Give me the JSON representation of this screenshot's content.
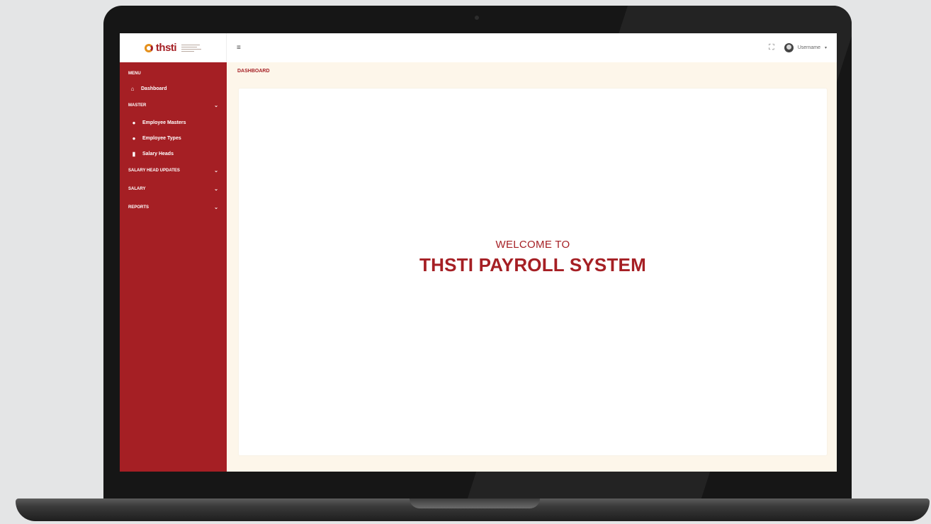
{
  "brand": {
    "logo_text": "thsti"
  },
  "sidebar": {
    "menu_title": "MENU",
    "dashboard": {
      "label": "Dashboard",
      "icon": "home-icon"
    },
    "groups": [
      {
        "label": "MASTER",
        "expanded": true,
        "items": [
          {
            "label": "Employee Masters",
            "icon": "user-icon"
          },
          {
            "label": "Employee Types",
            "icon": "user-icon"
          },
          {
            "label": "Salary Heads",
            "icon": "document-icon"
          }
        ]
      },
      {
        "label": "SALARY HEAD UPDATES",
        "expanded": false
      },
      {
        "label": "SALARY",
        "expanded": false
      },
      {
        "label": "REPORTS",
        "expanded": false
      }
    ]
  },
  "topbar": {
    "menu_icon": "menu-icon",
    "fullscreen_icon": "fullscreen-icon",
    "username": "Username"
  },
  "page": {
    "title": "DASHBOARD"
  },
  "welcome": {
    "line": "WELCOME TO",
    "title": "THSTI PAYROLL SYSTEM"
  },
  "colors": {
    "brand_red": "#a51f24",
    "accent_orange": "#e5901b",
    "content_bg": "#fdf6ea"
  }
}
